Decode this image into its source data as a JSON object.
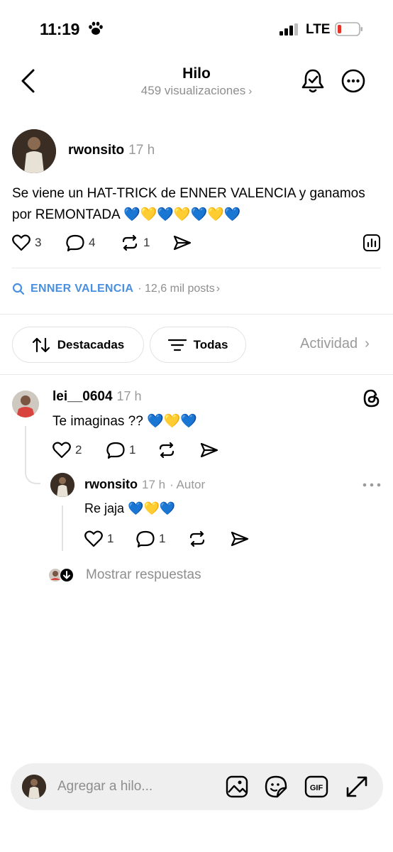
{
  "status_bar": {
    "time": "11:19",
    "network": "LTE"
  },
  "header": {
    "title": "Hilo",
    "views": "459 visualizaciones"
  },
  "post": {
    "username": "rwonsito",
    "time": "17 h",
    "text": "Se viene un HAT-TRICK de ENNER VALENCIA y ganamos por REMONTADA 💙💛💙💛💙💛💙",
    "likes": "3",
    "replies": "4",
    "reposts": "1"
  },
  "topic": {
    "name": "ENNER VALENCIA",
    "count": "· 12,6 mil posts"
  },
  "filters": {
    "sort_label": "Destacadas",
    "filter_label": "Todas",
    "activity_label": "Actividad"
  },
  "comments": [
    {
      "username": "lei__0604",
      "time": "17 h",
      "text": "Te imaginas ?? 💙💛💙",
      "likes": "2",
      "replies": "1"
    },
    {
      "username": "rwonsito",
      "time": "17 h",
      "author_tag": "· Autor",
      "text": "Re jaja 💙💛💙",
      "likes": "1",
      "replies": "1"
    }
  ],
  "show_replies": "Mostrar respuestas",
  "composer": {
    "placeholder": "Agregar a hilo..."
  },
  "colors": {
    "accent_blue": "#4a90e2",
    "muted_gray": "#8e8e8e",
    "battery_low": "#e5332a"
  }
}
